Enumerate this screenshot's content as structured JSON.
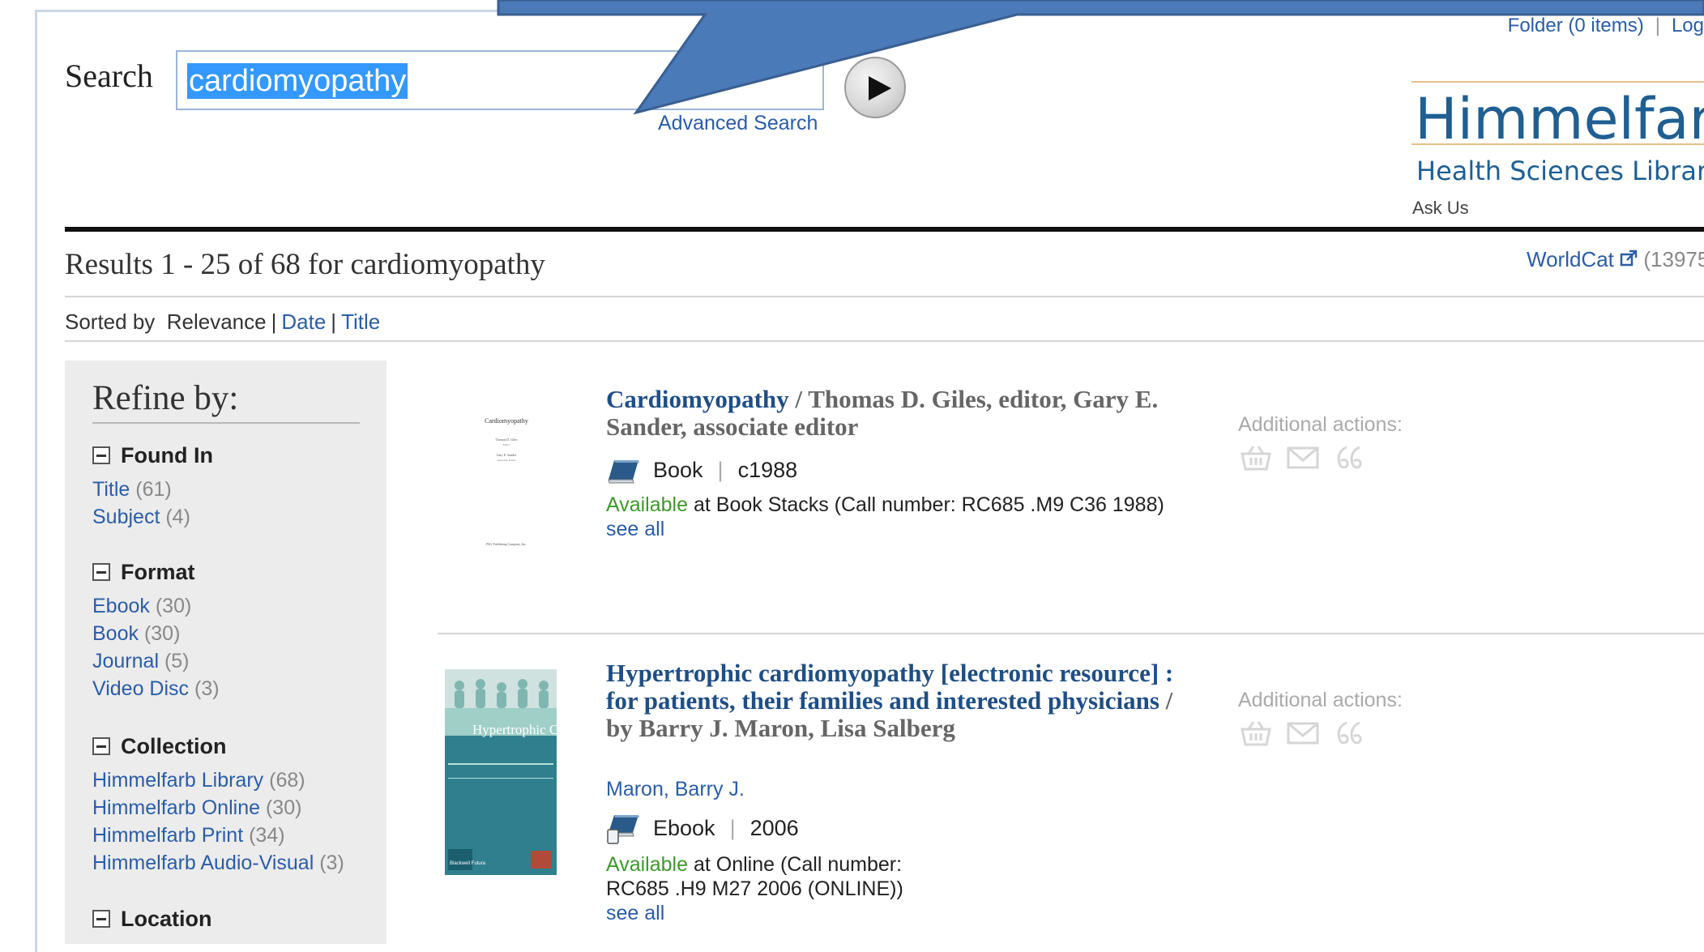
{
  "header": {
    "folder_label": "Folder (0 items)",
    "login_label": "Log"
  },
  "search": {
    "label": "Search",
    "value": "cardiomyopathy",
    "advanced_label": "Advanced Search",
    "go_icon": "play-icon"
  },
  "brand": {
    "title": "Himmelfarb",
    "subtitle": "Health Sciences Librar",
    "ask_us": "Ask Us"
  },
  "results_header": {
    "title": "Results 1 - 25 of 68 for cardiomyopathy",
    "worldcat_label": "WorldCat",
    "worldcat_count": "(13975"
  },
  "sort": {
    "label": "Sorted by",
    "current": "Relevance",
    "options": [
      "Date",
      "Title"
    ]
  },
  "refine": {
    "title": "Refine by:",
    "facets": [
      {
        "name": "Found In",
        "items": [
          {
            "label": "Title",
            "count": "(61)"
          },
          {
            "label": "Subject",
            "count": "(4)"
          }
        ]
      },
      {
        "name": "Format",
        "items": [
          {
            "label": "Ebook",
            "count": "(30)"
          },
          {
            "label": "Book",
            "count": "(30)"
          },
          {
            "label": "Journal",
            "count": "(5)"
          },
          {
            "label": "Video Disc",
            "count": "(3)"
          }
        ]
      },
      {
        "name": "Collection",
        "items": [
          {
            "label": "Himmelfarb Library",
            "count": "(68)"
          },
          {
            "label": "Himmelfarb Online",
            "count": "(30)"
          },
          {
            "label": "Himmelfarb Print",
            "count": "(34)"
          },
          {
            "label": "Himmelfarb Audio-Visual",
            "count": "(3)"
          }
        ]
      },
      {
        "name": "Location",
        "items": []
      }
    ]
  },
  "results": [
    {
      "title": "Cardiomyopathy",
      "responsibility": "/ Thomas D. Giles, editor, Gary E. Sander, associate editor",
      "author": "",
      "format": "Book",
      "date": "c1988",
      "availability": "Available",
      "location_text": "at Book Stacks (Call number: RC685 .M9 C36 1988)",
      "see_all": "see all",
      "actions_label": "Additional actions:",
      "thumb_lines": [
        "Cardiomyopathy",
        "Thomas D. Giles",
        "Editor",
        "Gary E. Sander",
        "Associate Editor",
        "PSG Publishing Company, Inc."
      ]
    },
    {
      "title": "Hypertrophic cardiomyopathy [electronic resource] : for patients, their families and interested physicians",
      "responsibility": "/ by Barry J. Maron, Lisa Salberg",
      "author": "Maron, Barry J.",
      "format": "Ebook",
      "date": "2006",
      "availability": "Available",
      "location_text": "at Online (Call number: RC685 .H9 M27 2006 (ONLINE))",
      "see_all": "see all",
      "actions_label": "Additional actions:",
      "cover_title": "Hypertrophic Cardiomyopathy",
      "cover_publisher": "Blackwell Futura"
    }
  ],
  "colors": {
    "link": "#2a5da8",
    "title": "#1f4e86",
    "available": "#3c9a2a",
    "callout": "#4a7ab8",
    "cover": "#2f7f8f"
  }
}
